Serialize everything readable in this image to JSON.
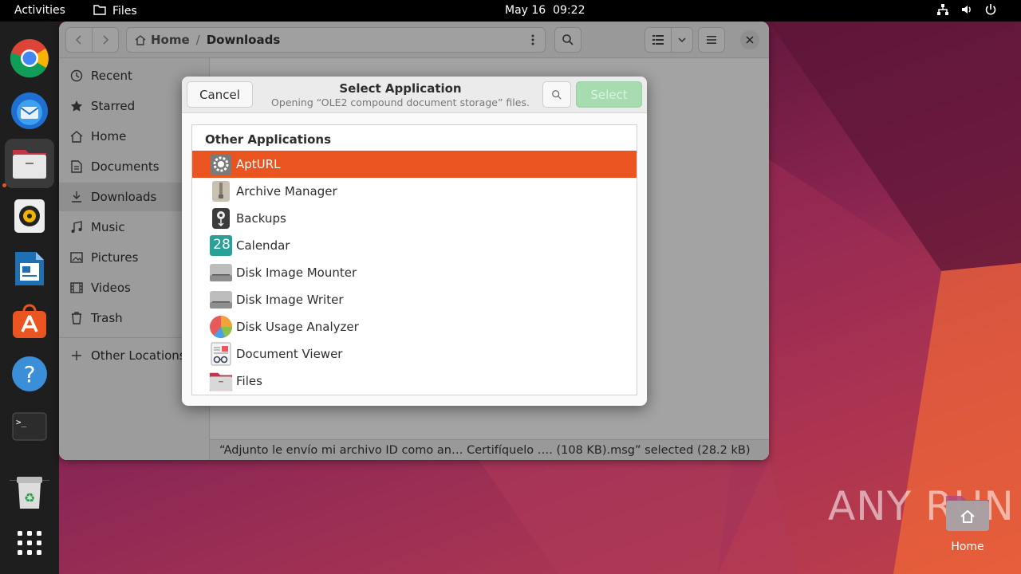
{
  "topbar": {
    "activities": "Activities",
    "app_name": "Files",
    "date": "May 16",
    "time": "09:22"
  },
  "dock": {
    "items": [
      "chrome-icon",
      "thunderbird-icon",
      "files-icon",
      "rhythmbox-icon",
      "libreoffice-writer-icon",
      "app-center-icon",
      "help-icon",
      "terminal-icon",
      "trash-icon",
      "app-grid-icon"
    ]
  },
  "files": {
    "path_home": "Home",
    "path_separator": "/",
    "path_current": "Downloads",
    "sidebar": [
      {
        "label": "Recent",
        "icon": "clock-icon"
      },
      {
        "label": "Starred",
        "icon": "star-icon"
      },
      {
        "label": "Home",
        "icon": "home-icon"
      },
      {
        "label": "Documents",
        "icon": "document-icon"
      },
      {
        "label": "Downloads",
        "icon": "download-icon"
      },
      {
        "label": "Music",
        "icon": "music-icon"
      },
      {
        "label": "Pictures",
        "icon": "picture-icon"
      },
      {
        "label": "Videos",
        "icon": "video-icon"
      },
      {
        "label": "Trash",
        "icon": "trash-icon"
      }
    ],
    "other_locations": "Other Locations",
    "status": "“Adjunto le envío mi archivo ID como an… Certifíquelo …. (108 KB).msg” selected (28.2 kB)"
  },
  "dialog": {
    "cancel": "Cancel",
    "title": "Select Application",
    "subtitle": "Opening “OLE2 compound document storage” files.",
    "select": "Select",
    "list_heading": "Other Applications",
    "apps": [
      {
        "name": "AptURL",
        "icon": "apturl-gear-icon",
        "selected": true
      },
      {
        "name": "Archive Manager",
        "icon": "archive-manager-icon",
        "selected": false
      },
      {
        "name": "Backups",
        "icon": "backups-icon",
        "selected": false
      },
      {
        "name": "Calendar",
        "icon": "calendar-icon",
        "calendar_day": "28",
        "selected": false
      },
      {
        "name": "Disk Image Mounter",
        "icon": "disk-image-icon",
        "selected": false
      },
      {
        "name": "Disk Image Writer",
        "icon": "disk-image-icon",
        "selected": false
      },
      {
        "name": "Disk Usage Analyzer",
        "icon": "disk-usage-icon",
        "selected": false
      },
      {
        "name": "Document Viewer",
        "icon": "document-viewer-icon",
        "selected": false
      },
      {
        "name": "Files",
        "icon": "files-icon",
        "selected": false
      }
    ]
  },
  "desktop": {
    "home_label": "Home",
    "watermark": "ANY RUN"
  },
  "colors": {
    "accent": "#e95420",
    "select_button": "#a6dcb0"
  }
}
